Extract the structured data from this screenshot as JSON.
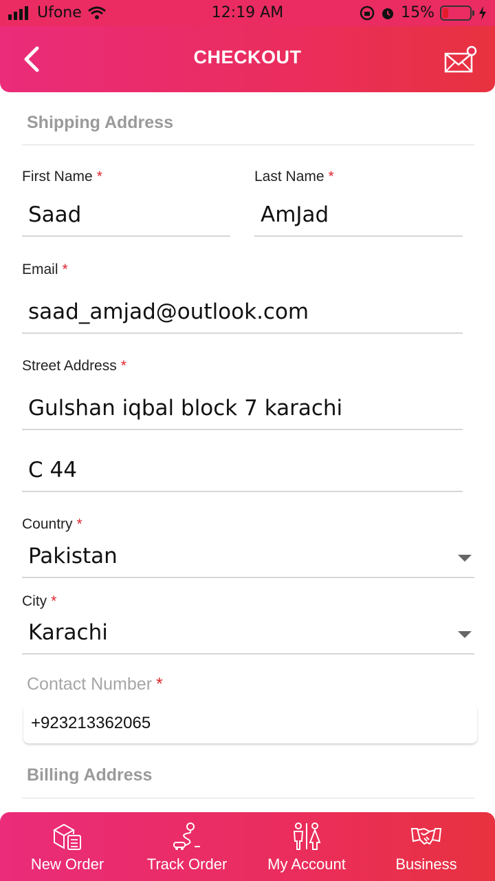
{
  "status_bar": {
    "carrier": "Ufone",
    "time": "12:19 AM",
    "battery_percent": "15%",
    "battery_level": 0.15,
    "icons": [
      "signal-icon",
      "wifi-icon",
      "orientation-lock-icon",
      "alarm-icon",
      "battery-icon",
      "charging-icon"
    ]
  },
  "header": {
    "title": "CHECKOUT",
    "back_icon": "back-chevron-icon",
    "mail_icon": "mail-notification-icon"
  },
  "shipping": {
    "section_title": "Shipping Address",
    "first_name": {
      "label": "First Name",
      "required": "*",
      "value": "Saad"
    },
    "last_name": {
      "label": "Last Name",
      "required": "*",
      "value": "AmJad"
    },
    "email": {
      "label": "Email",
      "required": "*",
      "value": "saad_amjad@outlook.com"
    },
    "street": {
      "label": "Street Address",
      "required": "*",
      "line1": "Gulshan iqbal block 7 karachi",
      "line2": "C 44"
    },
    "country": {
      "label": "Country",
      "required": "*",
      "value": "Pakistan"
    },
    "city": {
      "label": "City",
      "required": "*",
      "value": "Karachi"
    },
    "contact": {
      "label": "Contact Number",
      "required": "*",
      "value": "+923213362065"
    }
  },
  "billing": {
    "section_title": "Billing Address"
  },
  "bottom_nav": [
    {
      "label": "New Order",
      "icon": "box-checklist-icon"
    },
    {
      "label": "Track Order",
      "icon": "route-pin-icon"
    },
    {
      "label": "My Account",
      "icon": "people-icon"
    },
    {
      "label": "Business",
      "icon": "handshake-icon"
    }
  ],
  "colors": {
    "accent": "#ea2d5c",
    "required": "#e0242f"
  }
}
